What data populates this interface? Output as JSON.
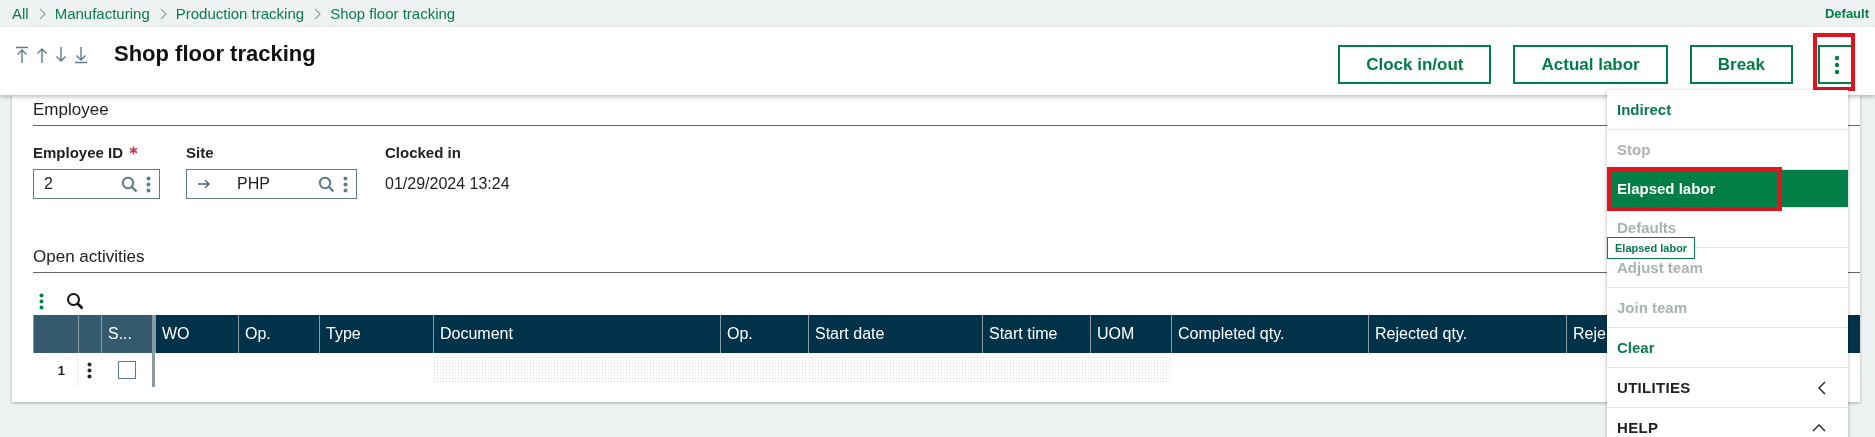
{
  "breadcrumb": [
    "All",
    "Manufacturing",
    "Production tracking",
    "Shop floor tracking"
  ],
  "profile": "Default",
  "title": "Shop floor tracking",
  "actions": [
    {
      "label": "Clock in/out"
    },
    {
      "label": "Actual labor"
    },
    {
      "label": "Break"
    }
  ],
  "more_button": {
    "highlighted": true
  },
  "employee": {
    "title": "Employee",
    "fields": [
      {
        "label": "Employee ID",
        "required": true,
        "kind": "lookup",
        "value": "2"
      },
      {
        "label": "Site",
        "required": false,
        "kind": "link-lookup",
        "value": "PHP"
      },
      {
        "label": "Clocked in",
        "required": false,
        "kind": "display",
        "value": "01/29/2024 13:24"
      }
    ]
  },
  "activities": {
    "title": "Open activities",
    "columns": [
      {
        "label": "S...",
        "frozen": true
      },
      {
        "label": "WO",
        "frozen": false,
        "shaded": false
      },
      {
        "label": "Op.",
        "frozen": false,
        "shaded": false
      },
      {
        "label": "Type",
        "frozen": false,
        "shaded": false
      },
      {
        "label": "Document",
        "frozen": false,
        "shaded": true
      },
      {
        "label": "Op.",
        "frozen": false,
        "shaded": true
      },
      {
        "label": "Start date",
        "frozen": false,
        "shaded": true
      },
      {
        "label": "Start time",
        "frozen": false,
        "shaded": true
      },
      {
        "label": "UOM",
        "frozen": false,
        "shaded": true
      },
      {
        "label": "Completed qty.",
        "frozen": false,
        "shaded": false
      },
      {
        "label": "Rejected qty.",
        "frozen": false,
        "shaded": false
      },
      {
        "label": "Reje",
        "frozen": false,
        "shaded": false
      }
    ],
    "rows": [
      {
        "number": "1",
        "checked": false
      }
    ]
  },
  "menu": {
    "items": [
      {
        "label": "Indirect",
        "kind": "action",
        "disabled": false,
        "selected": false,
        "highlighted": false
      },
      {
        "label": "Stop",
        "kind": "action",
        "disabled": true,
        "selected": false,
        "highlighted": false
      },
      {
        "label": "Elapsed labor",
        "kind": "action",
        "disabled": false,
        "selected": true,
        "highlighted": true
      },
      {
        "label": "Defaults",
        "kind": "action",
        "disabled": true,
        "selected": false,
        "highlighted": false
      },
      {
        "label": "Adjust team",
        "kind": "action",
        "disabled": true,
        "selected": false,
        "highlighted": false
      },
      {
        "label": "Join team",
        "kind": "action",
        "disabled": true,
        "selected": false,
        "highlighted": false
      },
      {
        "label": "Clear",
        "kind": "action",
        "disabled": false,
        "selected": false,
        "highlighted": false
      },
      {
        "label": "UTILITIES",
        "kind": "section",
        "expanded": false
      },
      {
        "label": "HELP",
        "kind": "section",
        "expanded": true
      }
    ]
  },
  "tooltip": "Elapsed labor"
}
